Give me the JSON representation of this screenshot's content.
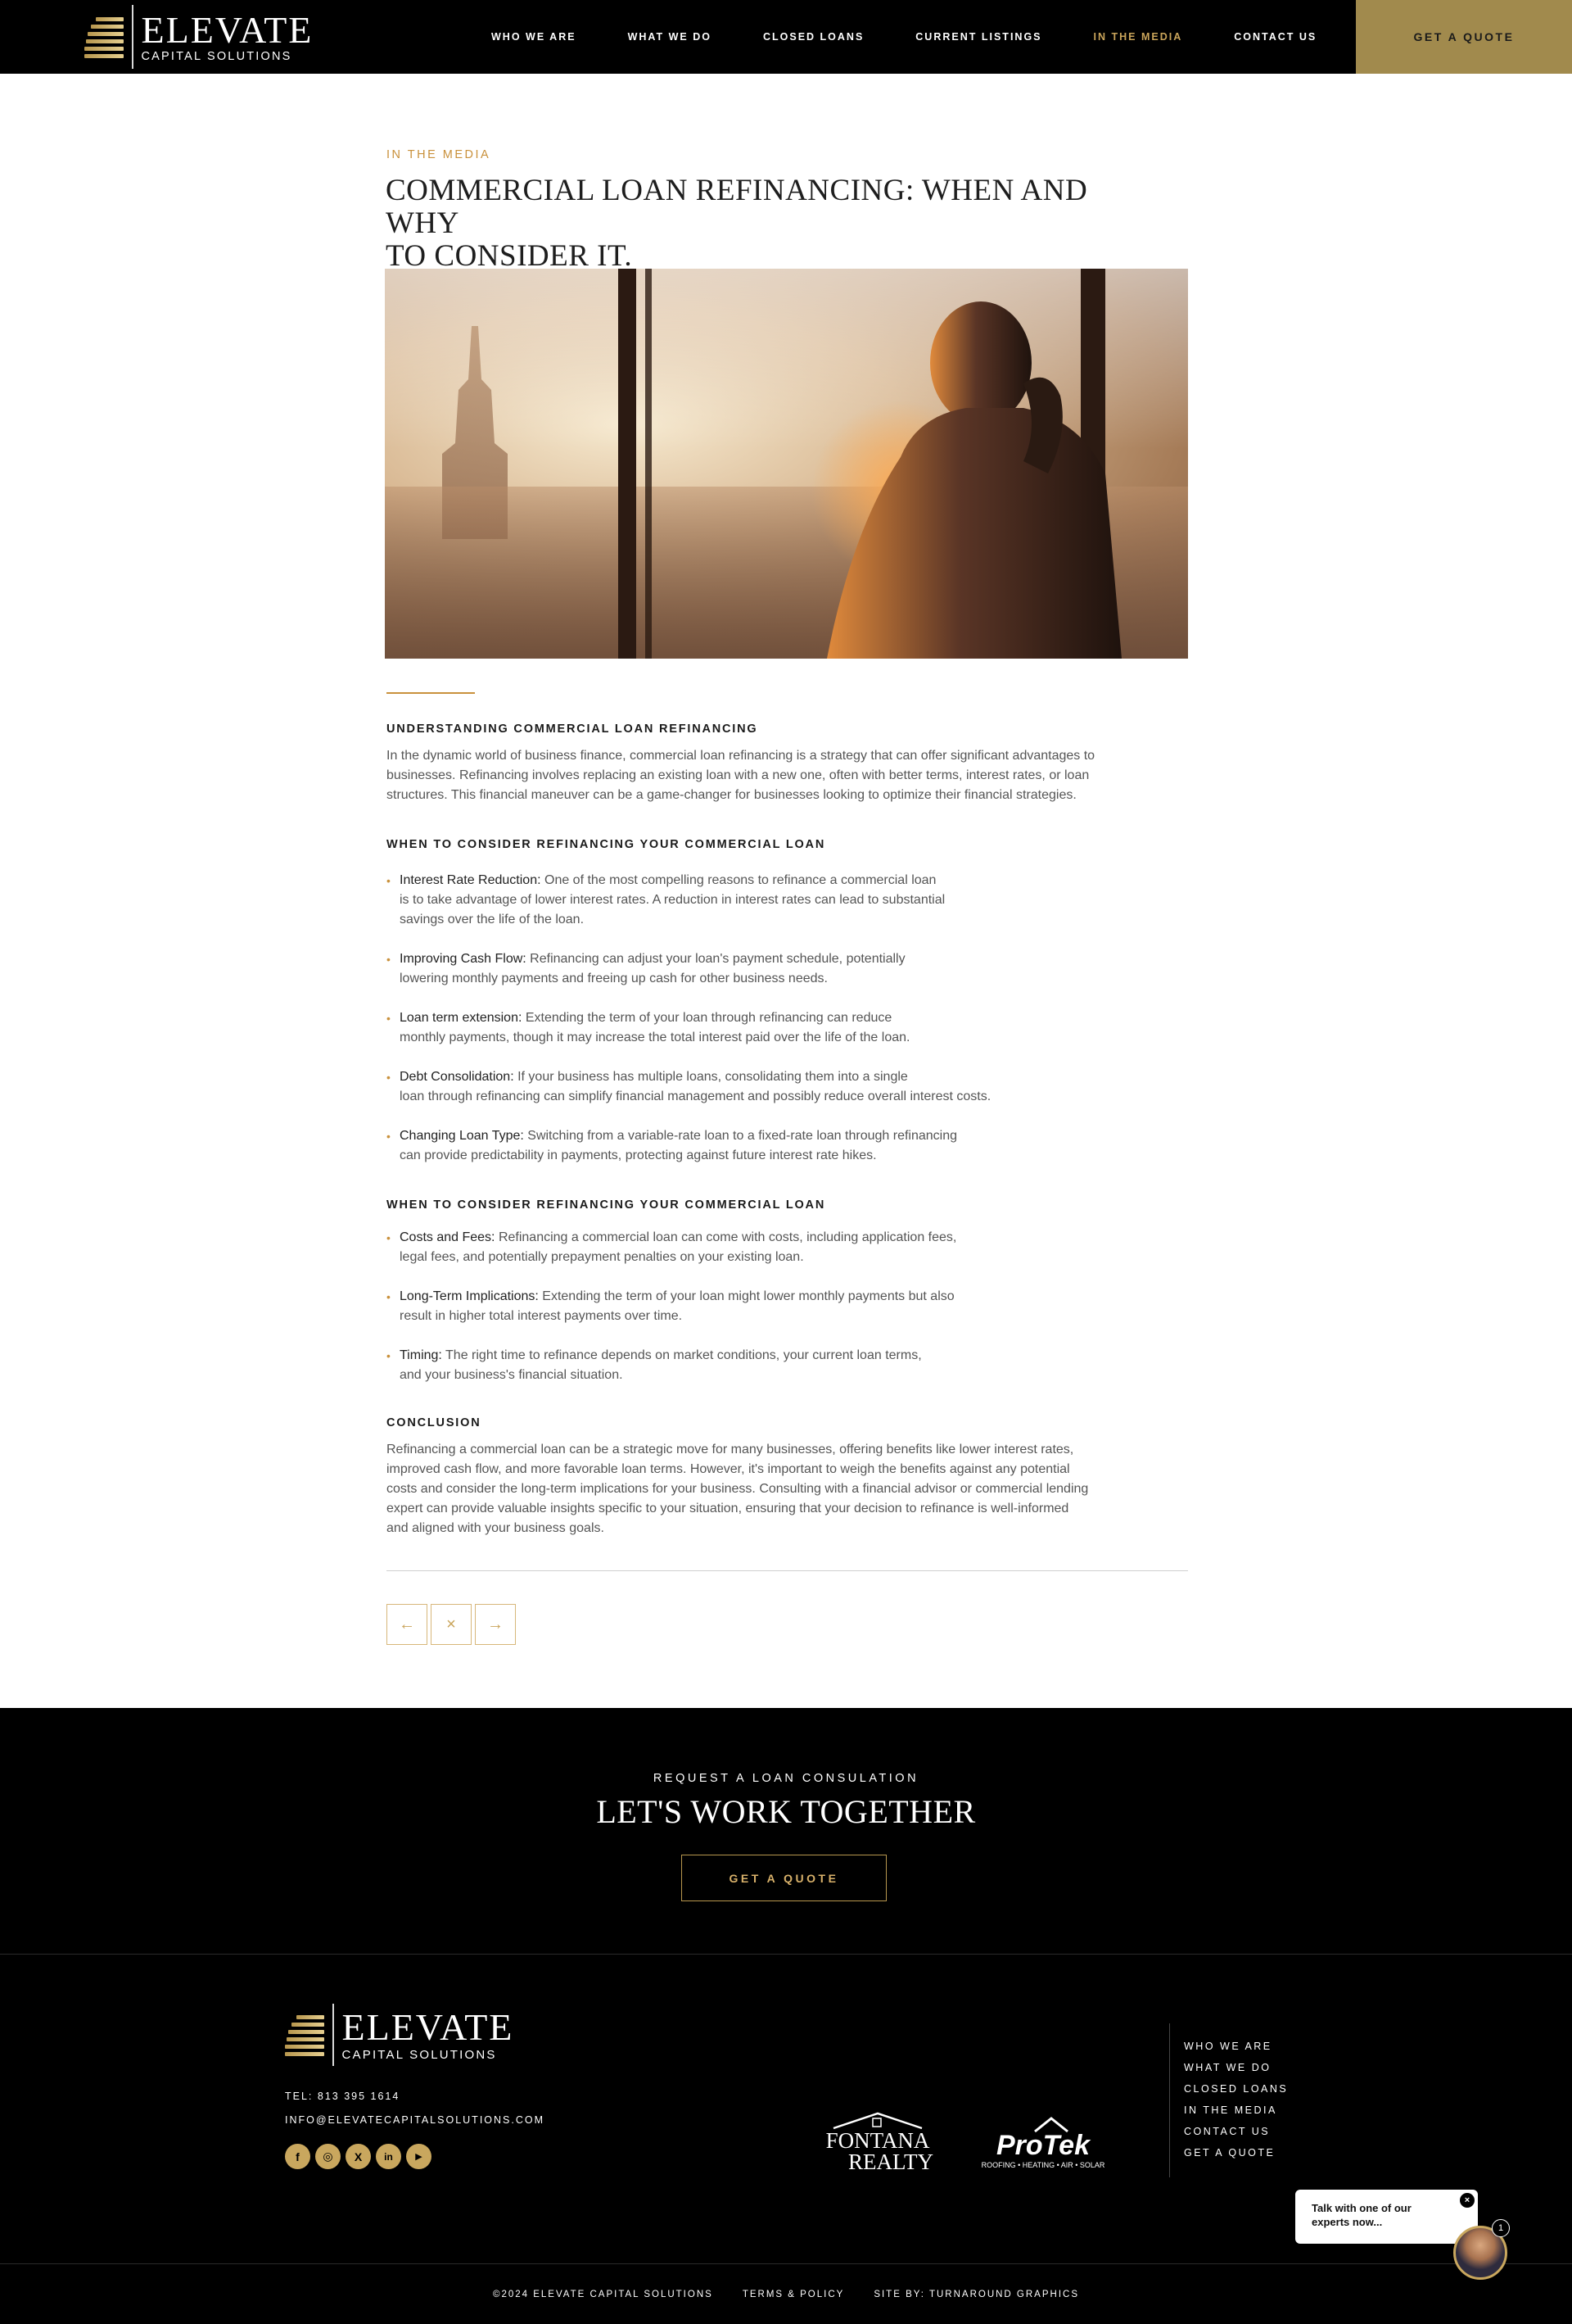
{
  "header": {
    "logo": {
      "name": "ELEVATE",
      "sub": "CAPITAL SOLUTIONS"
    },
    "nav": [
      {
        "label": "WHO WE ARE"
      },
      {
        "label": "WHAT WE DO"
      },
      {
        "label": "CLOSED LOANS"
      },
      {
        "label": "CURRENT LISTINGS"
      },
      {
        "label": "IN THE MEDIA",
        "active": true
      },
      {
        "label": "CONTACT US"
      }
    ],
    "cta_label": "GET A QUOTE"
  },
  "article": {
    "eyebrow": "IN THE MEDIA",
    "title_line1": "COMMERCIAL LOAN REFINANCING: WHEN AND WHY",
    "title_line2": "TO CONSIDER IT.",
    "sections": {
      "understanding": {
        "heading": "UNDERSTANDING COMMERCIAL LOAN REFINANCING",
        "lines": [
          "In the dynamic world of business finance, commercial loan refinancing is a strategy that can offer significant advantages to",
          "businesses. Refinancing involves replacing an existing loan with a new one, often with better terms, interest rates, or loan",
          "structures. This financial maneuver can be a game-changer for businesses looking to optimize their financial strategies."
        ]
      },
      "when": {
        "heading": "WHEN TO CONSIDER REFINANCING YOUR COMMERCIAL LOAN",
        "bullets": [
          {
            "term": "Interest Rate Reduction:",
            "line1": " One of the most compelling reasons to refinance a commercial loan",
            "line2": "is to take advantage of lower interest rates. A reduction in interest rates can lead to substantial",
            "line3": "savings over the life of the loan."
          },
          {
            "term": "Improving Cash Flow:",
            "line1": " Refinancing can adjust your loan's payment schedule, potentially",
            "line2": "lowering monthly payments and freeing up cash for other business needs."
          },
          {
            "term": "Loan term extension:",
            "line1": " Extending the term of your loan through refinancing can reduce",
            "line2": "monthly payments, though it may increase the total interest paid over the life of the loan."
          },
          {
            "term": "Debt Consolidation:",
            "line1": " If your business has multiple loans, consolidating them into a single",
            "line2": "loan through refinancing can simplify financial management and possibly reduce overall interest costs."
          },
          {
            "term": "Changing Loan Type:",
            "line1": " Switching from a variable-rate loan to a fixed-rate loan through refinancing",
            "line2": "can provide predictability in payments, protecting against future interest rate hikes."
          }
        ]
      },
      "considerations": {
        "heading": "WHEN TO CONSIDER REFINANCING YOUR COMMERCIAL LOAN",
        "bullets": [
          {
            "term": "Costs and Fees:",
            "line1": " Refinancing a commercial loan can come with costs, including application fees,",
            "line2": "legal fees, and potentially prepayment penalties on your existing loan."
          },
          {
            "term": "Long-Term Implications:",
            "line1": " Extending the term of your loan might lower monthly payments but also",
            "line2": "result in higher total interest payments over time."
          },
          {
            "term": "Timing:",
            "line1": " The right time to refinance depends on market conditions, your current loan terms,",
            "line2": "and your business's financial situation."
          }
        ]
      },
      "conclusion": {
        "heading": "CONCLUSION",
        "lines": [
          "Refinancing a commercial loan can be a strategic move for many businesses, offering benefits like lower interest rates,",
          "improved cash flow, and more favorable loan terms. However, it's important to weigh the benefits against any potential",
          "costs and consider the long-term implications for your business. Consulting with a financial advisor or commercial lending",
          "expert can provide valuable insights specific to your situation, ensuring that your decision to refinance is well-informed",
          "and aligned with your business goals."
        ]
      }
    },
    "pager": {
      "prev": "←",
      "close": "×",
      "next": "→"
    }
  },
  "cta": {
    "eyebrow": "REQUEST A LOAN CONSULATION",
    "title": "LET'S WORK TOGETHER",
    "button": "GET A QUOTE"
  },
  "footer": {
    "tel": "TEL: 813 395 1614",
    "email": "INFO@ELEVATECAPITALSOLUTIONS.COM",
    "socials": [
      {
        "icon": "facebook-icon",
        "glyph": "f"
      },
      {
        "icon": "instagram-icon",
        "glyph": "◎"
      },
      {
        "icon": "x-icon",
        "glyph": "X"
      },
      {
        "icon": "linkedin-icon",
        "glyph": "in"
      },
      {
        "icon": "youtube-icon",
        "glyph": "▶"
      }
    ],
    "partners": {
      "fontana_line1": "FONTANA",
      "fontana_line2": "REALTY",
      "protek_name": "ProTek",
      "protek_tag": "ROOFING • HEATING • AIR • SOLAR"
    },
    "nav": [
      "WHO WE ARE",
      "WHAT WE DO",
      "CLOSED LOANS",
      "IN THE MEDIA",
      "CONTACT US",
      "GET A QUOTE"
    ],
    "bottom": {
      "copyright": "©2024 ELEVATE CAPITAL SOLUTIONS",
      "terms": "TERMS & POLICY",
      "credit": "SITE BY: TURNAROUND GRAPHICS"
    }
  },
  "chat": {
    "line1": "Talk with one of our",
    "line2": "experts now...",
    "close": "×",
    "count": "1"
  },
  "colors": {
    "gold": "#c9913c",
    "button_gold": "#a18a4d",
    "black": "#000000"
  }
}
